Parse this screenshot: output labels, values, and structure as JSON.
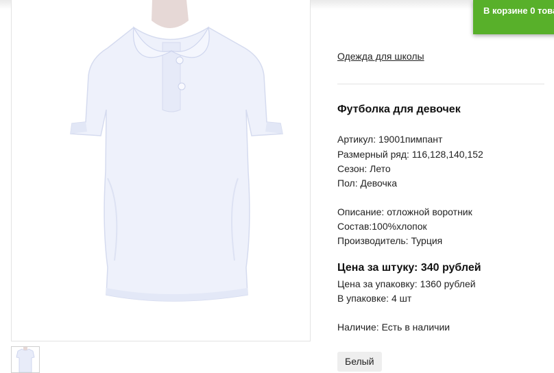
{
  "cart": {
    "label": "В корзине 0 това"
  },
  "breadcrumb": {
    "category": "Одежда для школы"
  },
  "product": {
    "title": "Футболка для девочек",
    "article": "Артикул: 19001пимпант",
    "sizes": "Размерный ряд: 116,128,140,152",
    "season": "Сезон: Лето",
    "gender": "Пол: Девочка",
    "description": "Описание: отложной воротник",
    "composition": "Состав:100%хлопок",
    "manufacturer": "Производитель: Турция",
    "price_unit": "Цена за штуку: 340 рублей",
    "price_pack": "Цена за упаковку: 1360 рублей",
    "pack_count": "В упаковке: 4 шт",
    "availability": "Наличие: Есть в наличии",
    "color_option": "Белый"
  },
  "colors": {
    "cart_green": "#58b02a",
    "shirt": "#eef1fb"
  },
  "icons": {
    "main_image": "white-polo-shirt-image",
    "thumbnail": "white-polo-shirt-thumbnail"
  }
}
